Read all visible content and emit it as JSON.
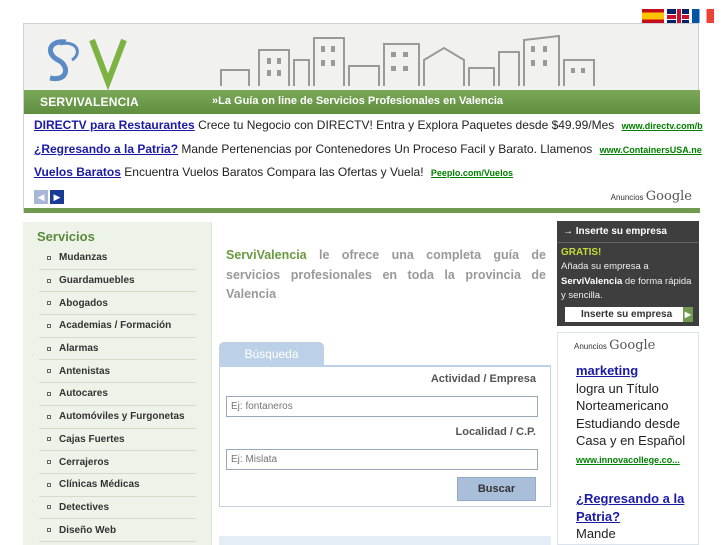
{
  "flags": [
    {
      "lang": "es",
      "icon": "spain-flag-icon"
    },
    {
      "lang": "en",
      "icon": "uk-flag-icon"
    },
    {
      "lang": "fr",
      "icon": "france-flag-icon"
    }
  ],
  "header": {
    "logo_text": "SV",
    "brand": "SERVIVALENCIA",
    "tagline": "»La Guía on line de Servicios Profesionales en Valencia",
    "colors": {
      "green": "#6f9a4f",
      "logo_blue": "#5b8bc4",
      "logo_green": "#7cb342"
    }
  },
  "top_ads": {
    "items": [
      {
        "title": "DIRECTV para Restaurantes",
        "text": "Crece tu Negocio con DIRECTV! Entra y Explora Paquetes desde $49.99/Mes",
        "url": "www.directv.com/b"
      },
      {
        "title": "¿Regresando a la Patria?",
        "text": "Mande Pertenencias por Contenedores Un Proceso Facil y Barato. Llamenos",
        "url": "www.ContainersUSA.ne"
      },
      {
        "title": "Vuelos Baratos",
        "text": "Encuentra Vuelos Baratos Compara las Ofertas y Vuela!",
        "url": "Peeplo.com/Vuelos"
      }
    ],
    "credit_prefix": "Anuncios",
    "credit_brand": "Google"
  },
  "sidebar": {
    "title": "Servicios",
    "items": [
      "Mudanzas",
      "Guardamuebles",
      "Abogados",
      "Academias / Formación",
      "Alarmas",
      "Antenistas",
      "Autocares",
      "Automóviles y Furgonetas",
      "Cajas Fuertes",
      "Cerrajeros",
      "Clínicas Médicas",
      "Detectives",
      "Diseño Web"
    ]
  },
  "intro": {
    "brand": "ServiValencia",
    "text": " le ofrece una completa guía de servicios profesionales en toda la provincia de Valencia"
  },
  "search": {
    "tab": "Búsqueda",
    "activity_label": "Actividad / Empresa",
    "activity_placeholder": "Ej: fontaneros",
    "location_label": "Localidad / C.P.",
    "location_placeholder": "Ej: Mislata",
    "button": "Buscar"
  },
  "promo": {
    "title": "Inserte su empresa",
    "gratis": "GRATIS!",
    "text_before": "Añada su empresa a ",
    "text_brand": "ServiValencia",
    "text_after": " de forma rápida y sencilla.",
    "button": "Inserte su empresa"
  },
  "side_ads": {
    "credit_prefix": "Anuncios",
    "credit_brand": "Google",
    "items": [
      {
        "title": "marketing",
        "text": "logra un Título Norteamericano Estudiando desde Casa y en Español",
        "url": "www.innovacollege.co..."
      },
      {
        "title": "¿Regresando a la Patria?",
        "text": "Mande"
      }
    ]
  }
}
